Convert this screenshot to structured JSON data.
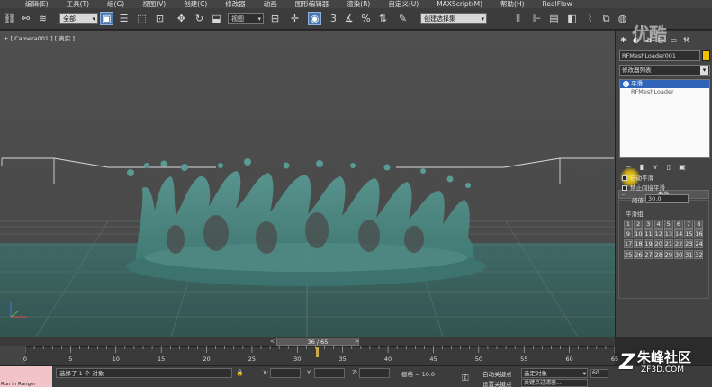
{
  "menu": [
    "编辑(E)",
    "工具(T)",
    "组(G)",
    "视图(V)",
    "创建(C)",
    "修改器",
    "动画",
    "图形编辑器",
    "渲染(R)",
    "自定义(U)",
    "MAXScript(M)",
    "帮助(H)",
    "RealFlow"
  ],
  "toolbar": {
    "filter_select": "全部",
    "coord_select": "视图",
    "named_sel": "创建选择集",
    "angle_snap_label": "3"
  },
  "viewport": {
    "label": "+ [ Camera001 ] [ 真实 ]"
  },
  "command_panel": {
    "object_name": "RFMeshLoader001",
    "object_color": "#f0c000",
    "modifier_list": "修改器列表",
    "stack": [
      {
        "label": "平滑",
        "selected": true
      },
      {
        "label": "RFMeshLoader",
        "selected": false
      }
    ],
    "rollout_title": "参数",
    "auto_smooth": "自动平滑",
    "prevent_indirect": "禁止间接平滑",
    "threshold_label": "阈值:",
    "threshold_value": "30.0",
    "smoothing_groups_label": "平滑组:",
    "smoothing_groups": [
      "1",
      "2",
      "3",
      "4",
      "5",
      "6",
      "7",
      "8",
      "9",
      "10",
      "11",
      "12",
      "13",
      "14",
      "15",
      "16",
      "17",
      "18",
      "19",
      "20",
      "21",
      "22",
      "23",
      "24",
      "25",
      "26",
      "27",
      "28",
      "29",
      "30",
      "31",
      "32"
    ]
  },
  "timeline": {
    "current": "36 / 65",
    "ticks": [
      "0",
      "5",
      "10",
      "15",
      "20",
      "25",
      "30",
      "35",
      "40",
      "45",
      "50",
      "55",
      "60",
      "65"
    ]
  },
  "status": {
    "script_hint": "Run in Ranger",
    "message": "选择了 1 个 对象",
    "x_label": "X:",
    "y_label": "Y:",
    "z_label": "Z:",
    "grid": "栅格 = 10.0",
    "auto_key": "自动关键点",
    "selected_object": "选定对象",
    "set_key": "设置关键点",
    "key_filter": "关键点过滤器...",
    "frame_field": "60"
  },
  "watermarks": {
    "youku": "优酷",
    "zf3d_name": "朱峰社区",
    "zf3d_url": "ZF3D.COM",
    "zf3d_logo": "Z"
  }
}
